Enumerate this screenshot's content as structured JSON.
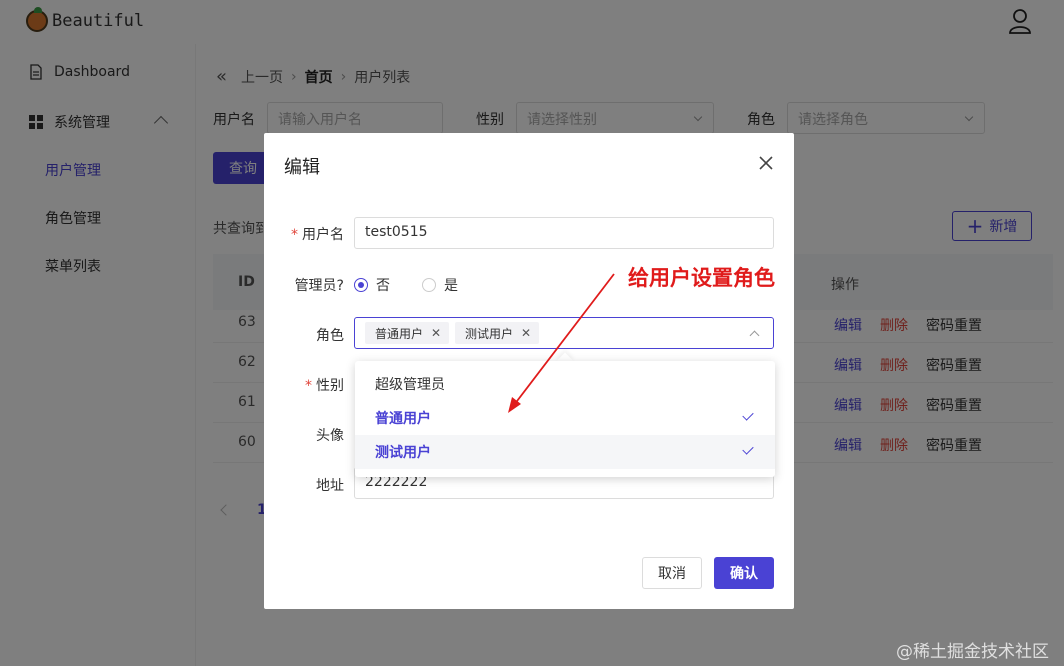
{
  "app": {
    "title": "Beautiful"
  },
  "sidebar": {
    "dashboard": "Dashboard",
    "system_group": "系统管理",
    "items": [
      "用户管理",
      "角色管理",
      "菜单列表"
    ],
    "active_index": 0
  },
  "breadcrumb": {
    "back": "上一页",
    "home": "首页",
    "current": "用户列表"
  },
  "filters": {
    "username_label": "用户名",
    "username_placeholder": "请输入用户名",
    "gender_label": "性别",
    "gender_placeholder": "请选择性别",
    "role_label": "角色",
    "role_placeholder": "请选择角色"
  },
  "toolbar": {
    "query_label": "查询",
    "total_text": "共查询到",
    "add_label": "新增"
  },
  "table": {
    "columns": {
      "id": "ID",
      "ops": "操作"
    },
    "rows": [
      {
        "id": "63"
      },
      {
        "id": "62"
      },
      {
        "id": "61"
      },
      {
        "id": "60"
      }
    ],
    "ops": {
      "edit": "编辑",
      "delete": "删除",
      "reset": "密码重置"
    }
  },
  "pager": {
    "current": "1"
  },
  "modal": {
    "title": "编辑",
    "fields": {
      "username_label": "用户名",
      "username_value": "test0515",
      "admin_label": "管理员?",
      "admin_no": "否",
      "admin_yes": "是",
      "role_label": "角色",
      "gender_label": "性别",
      "avatar_label": "头像",
      "address_label": "地址",
      "address_value": "2222222"
    },
    "role_tags": [
      "普通用户",
      "测试用户"
    ],
    "role_options": [
      {
        "label": "超级管理员",
        "selected": false
      },
      {
        "label": "普通用户",
        "selected": true
      },
      {
        "label": "测试用户",
        "selected": true
      }
    ],
    "cancel_label": "取消",
    "ok_label": "确认"
  },
  "annotation": {
    "text": "给用户设置角色"
  },
  "watermark": "@稀土掘金技术社区",
  "colors": {
    "primary": "#4a42d4",
    "danger": "#e0443a",
    "annotation": "#e01b1b"
  }
}
